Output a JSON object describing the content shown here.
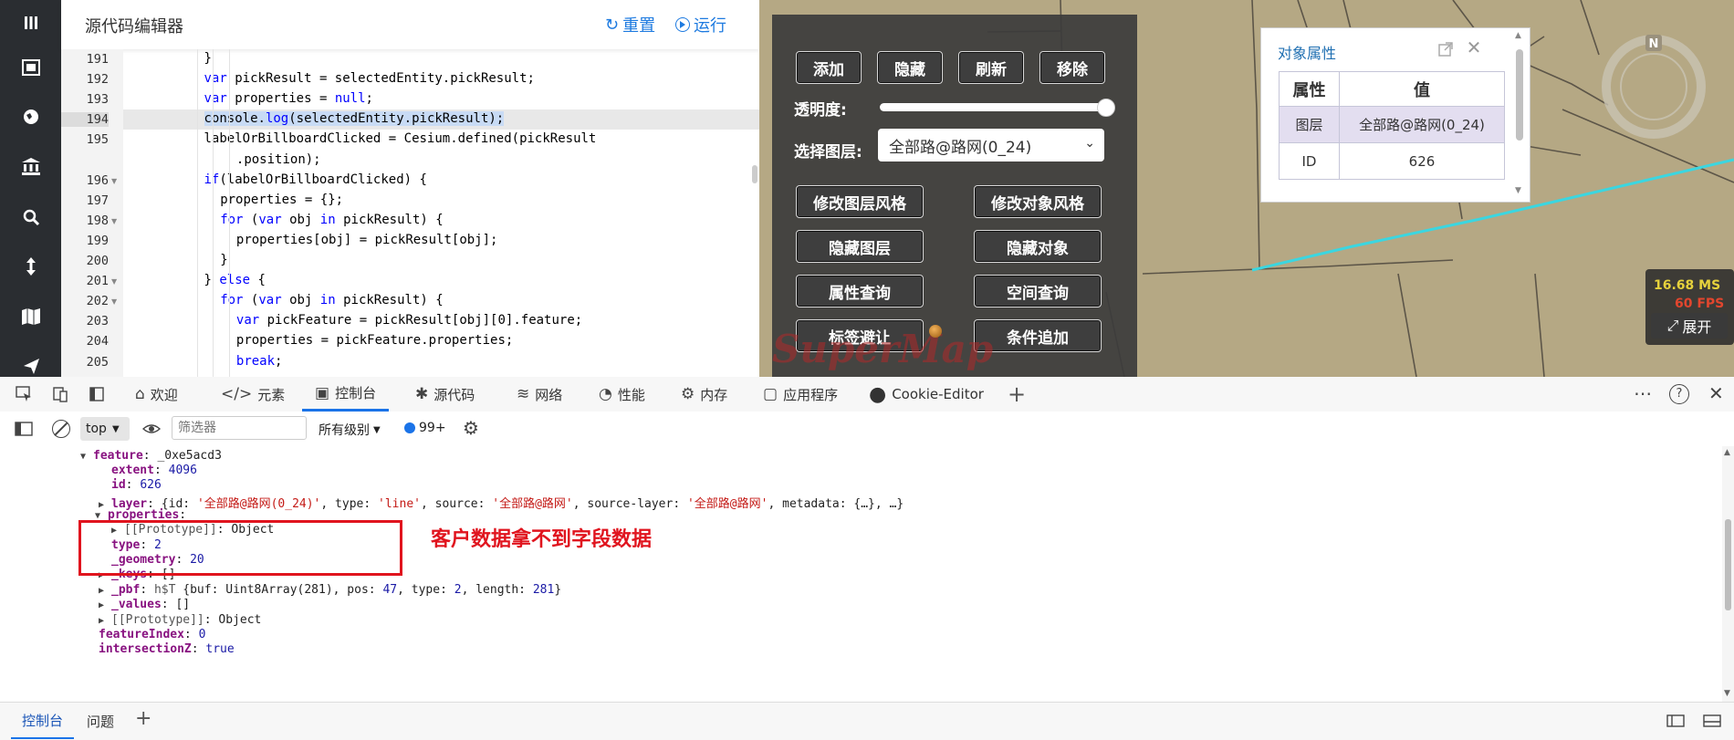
{
  "editor": {
    "title": "源代码编辑器",
    "reset_label": "重置",
    "run_label": "运行",
    "lines": [
      {
        "num": "191",
        "code": "}"
      },
      {
        "num": "192",
        "code": "var pickResult = selectedEntity.pickResult;"
      },
      {
        "num": "193",
        "code": "var properties = null;"
      },
      {
        "num": "194",
        "code": "console.log(selectedEntity.pickResult);"
      },
      {
        "num": "195",
        "code": "labelOrBillboardClicked = Cesium.defined(pickResult"
      },
      {
        "num": "",
        "code": ".position);"
      },
      {
        "num": "196",
        "code": "if(labelOrBillboardClicked) {"
      },
      {
        "num": "197",
        "code": "properties = {};"
      },
      {
        "num": "198",
        "code": "for (var obj in pickResult) {"
      },
      {
        "num": "199",
        "code": "properties[obj] = pickResult[obj];"
      },
      {
        "num": "200",
        "code": "}"
      },
      {
        "num": "201",
        "code": "} else {"
      },
      {
        "num": "202",
        "code": "for (var obj in pickResult) {"
      },
      {
        "num": "203",
        "code": "var pickFeature = pickResult[obj][0].feature;"
      },
      {
        "num": "204",
        "code": "properties = pickFeature.properties;"
      },
      {
        "num": "205",
        "code": "break;"
      }
    ]
  },
  "map_panel": {
    "buttons_row1": [
      "添加",
      "隐藏",
      "刷新",
      "移除"
    ],
    "opacity_label": "透明度:",
    "opacity_value": 1.0,
    "layer_label": "选择图层:",
    "layer_selected": "全部路@路网(0_24)",
    "buttons_grid": [
      "修改图层风格",
      "修改对象风格",
      "隐藏图层",
      "隐藏对象",
      "属性查询",
      "空间查询",
      "标签避让",
      "条件追加"
    ],
    "watermark": "SuperMap"
  },
  "prop_window": {
    "title": "对象属性",
    "col_attr": "属性",
    "col_value": "值",
    "rows": [
      {
        "attr": "图层",
        "value": "全部路@路网(0_24)"
      },
      {
        "attr": "ID",
        "value": "626"
      }
    ]
  },
  "stats": {
    "ms": "16.68 MS",
    "fps": "60 FPS",
    "expand_label": "展开"
  },
  "devtools": {
    "tabs": [
      {
        "icon": "home-icon",
        "label": "欢迎"
      },
      {
        "icon": "code-icon",
        "label": "元素"
      },
      {
        "icon": "console-icon",
        "label": "控制台"
      },
      {
        "icon": "bug-icon",
        "label": "源代码"
      },
      {
        "icon": "wifi-icon",
        "label": "网络"
      },
      {
        "icon": "gauge-icon",
        "label": "性能"
      },
      {
        "icon": "memory-icon",
        "label": "内存"
      },
      {
        "icon": "app-icon",
        "label": "应用程序"
      },
      {
        "icon": "cookie-icon",
        "label": "Cookie-Editor"
      }
    ],
    "active_tab": "控制台",
    "context": "top",
    "filter_placeholder": "筛选器",
    "levels": "所有级别",
    "message_count": "99+",
    "annotation": "客户数据拿不到字段数据",
    "bottom_tabs": [
      "控制台",
      "问题"
    ]
  },
  "console_lines": {
    "l1_key": "feature",
    "l1_val": "_0xe5acd3",
    "l2_key": "extent",
    "l2_val": "4096",
    "l3_key": "id",
    "l3_val": "626",
    "l4_key": "layer",
    "l4_id": "'全部路@路网(0_24)'",
    "l4_type": "'line'",
    "l4_source": "'全部路@路网'",
    "l4_sourcelayer": "'全部路@路网'",
    "l4_metadata": "{…}",
    "l5_key": "properties",
    "l6_text": "[[Prototype]]",
    "l6_val": "Object",
    "l7_key": "type",
    "l7_val": "2",
    "l8_key": "_geometry",
    "l8_val": "20",
    "l9_key": "_keys",
    "l9_val": "[]",
    "l10_key": "_pbf",
    "l10_cls": "h$T",
    "l10_buf": "Uint8Array(281)",
    "l10_pos": "47",
    "l10_type": "2",
    "l10_length": "281",
    "l11_key": "_values",
    "l11_val": "[]",
    "l12_text": "[[Prototype]]",
    "l12_val": "Object",
    "l13_key": "featureIndex",
    "l13_val": "0",
    "l14_key": "intersectionZ",
    "l14_val": "true"
  }
}
